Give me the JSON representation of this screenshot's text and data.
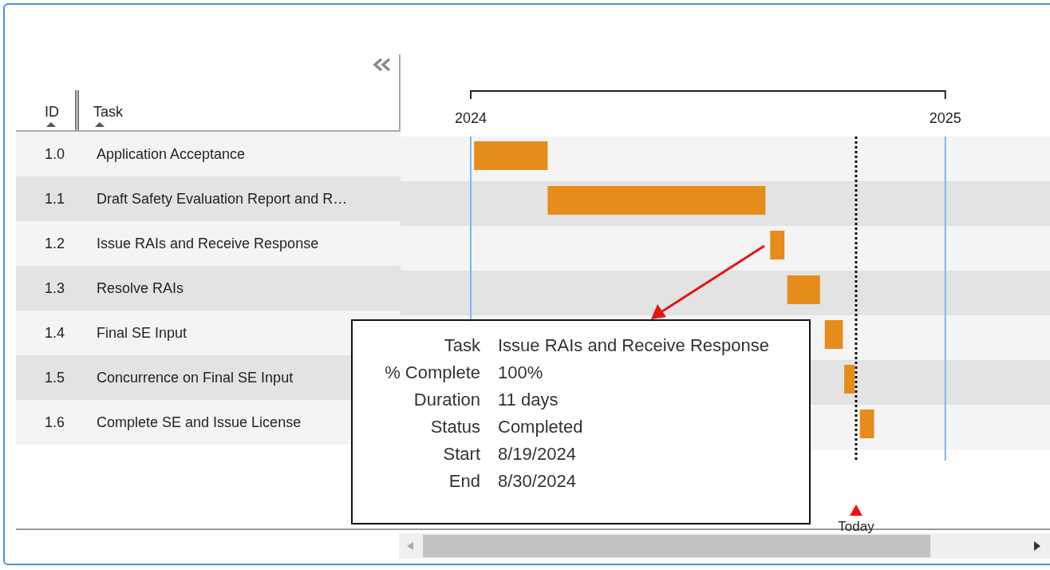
{
  "table": {
    "columns": [
      {
        "label": "ID",
        "sorted": true
      },
      {
        "label": "Task",
        "sorted": true
      }
    ],
    "rows": [
      {
        "id": "1.0",
        "task": "Application Acceptance"
      },
      {
        "id": "1.1",
        "task": "Draft Safety Evaluation Report and R…"
      },
      {
        "id": "1.2",
        "task": "Issue RAIs and Receive Response"
      },
      {
        "id": "1.3",
        "task": "Resolve RAIs"
      },
      {
        "id": "1.4",
        "task": "Final SE Input"
      },
      {
        "id": "1.5",
        "task": "Concurrence on Final SE Input"
      },
      {
        "id": "1.6",
        "task": "Complete SE and Issue License"
      }
    ]
  },
  "timeline": {
    "years": [
      "2024",
      "2025"
    ],
    "today": "Today"
  },
  "tooltip": {
    "fields": [
      {
        "label": "Task",
        "value": "Issue RAIs and Receive Response"
      },
      {
        "label": "% Complete",
        "value": "100%"
      },
      {
        "label": "Duration",
        "value": "11 days"
      },
      {
        "label": "Status",
        "value": "Completed"
      },
      {
        "label": "Start",
        "value": "8/19/2024"
      },
      {
        "label": "End",
        "value": "8/30/2024"
      }
    ]
  }
}
